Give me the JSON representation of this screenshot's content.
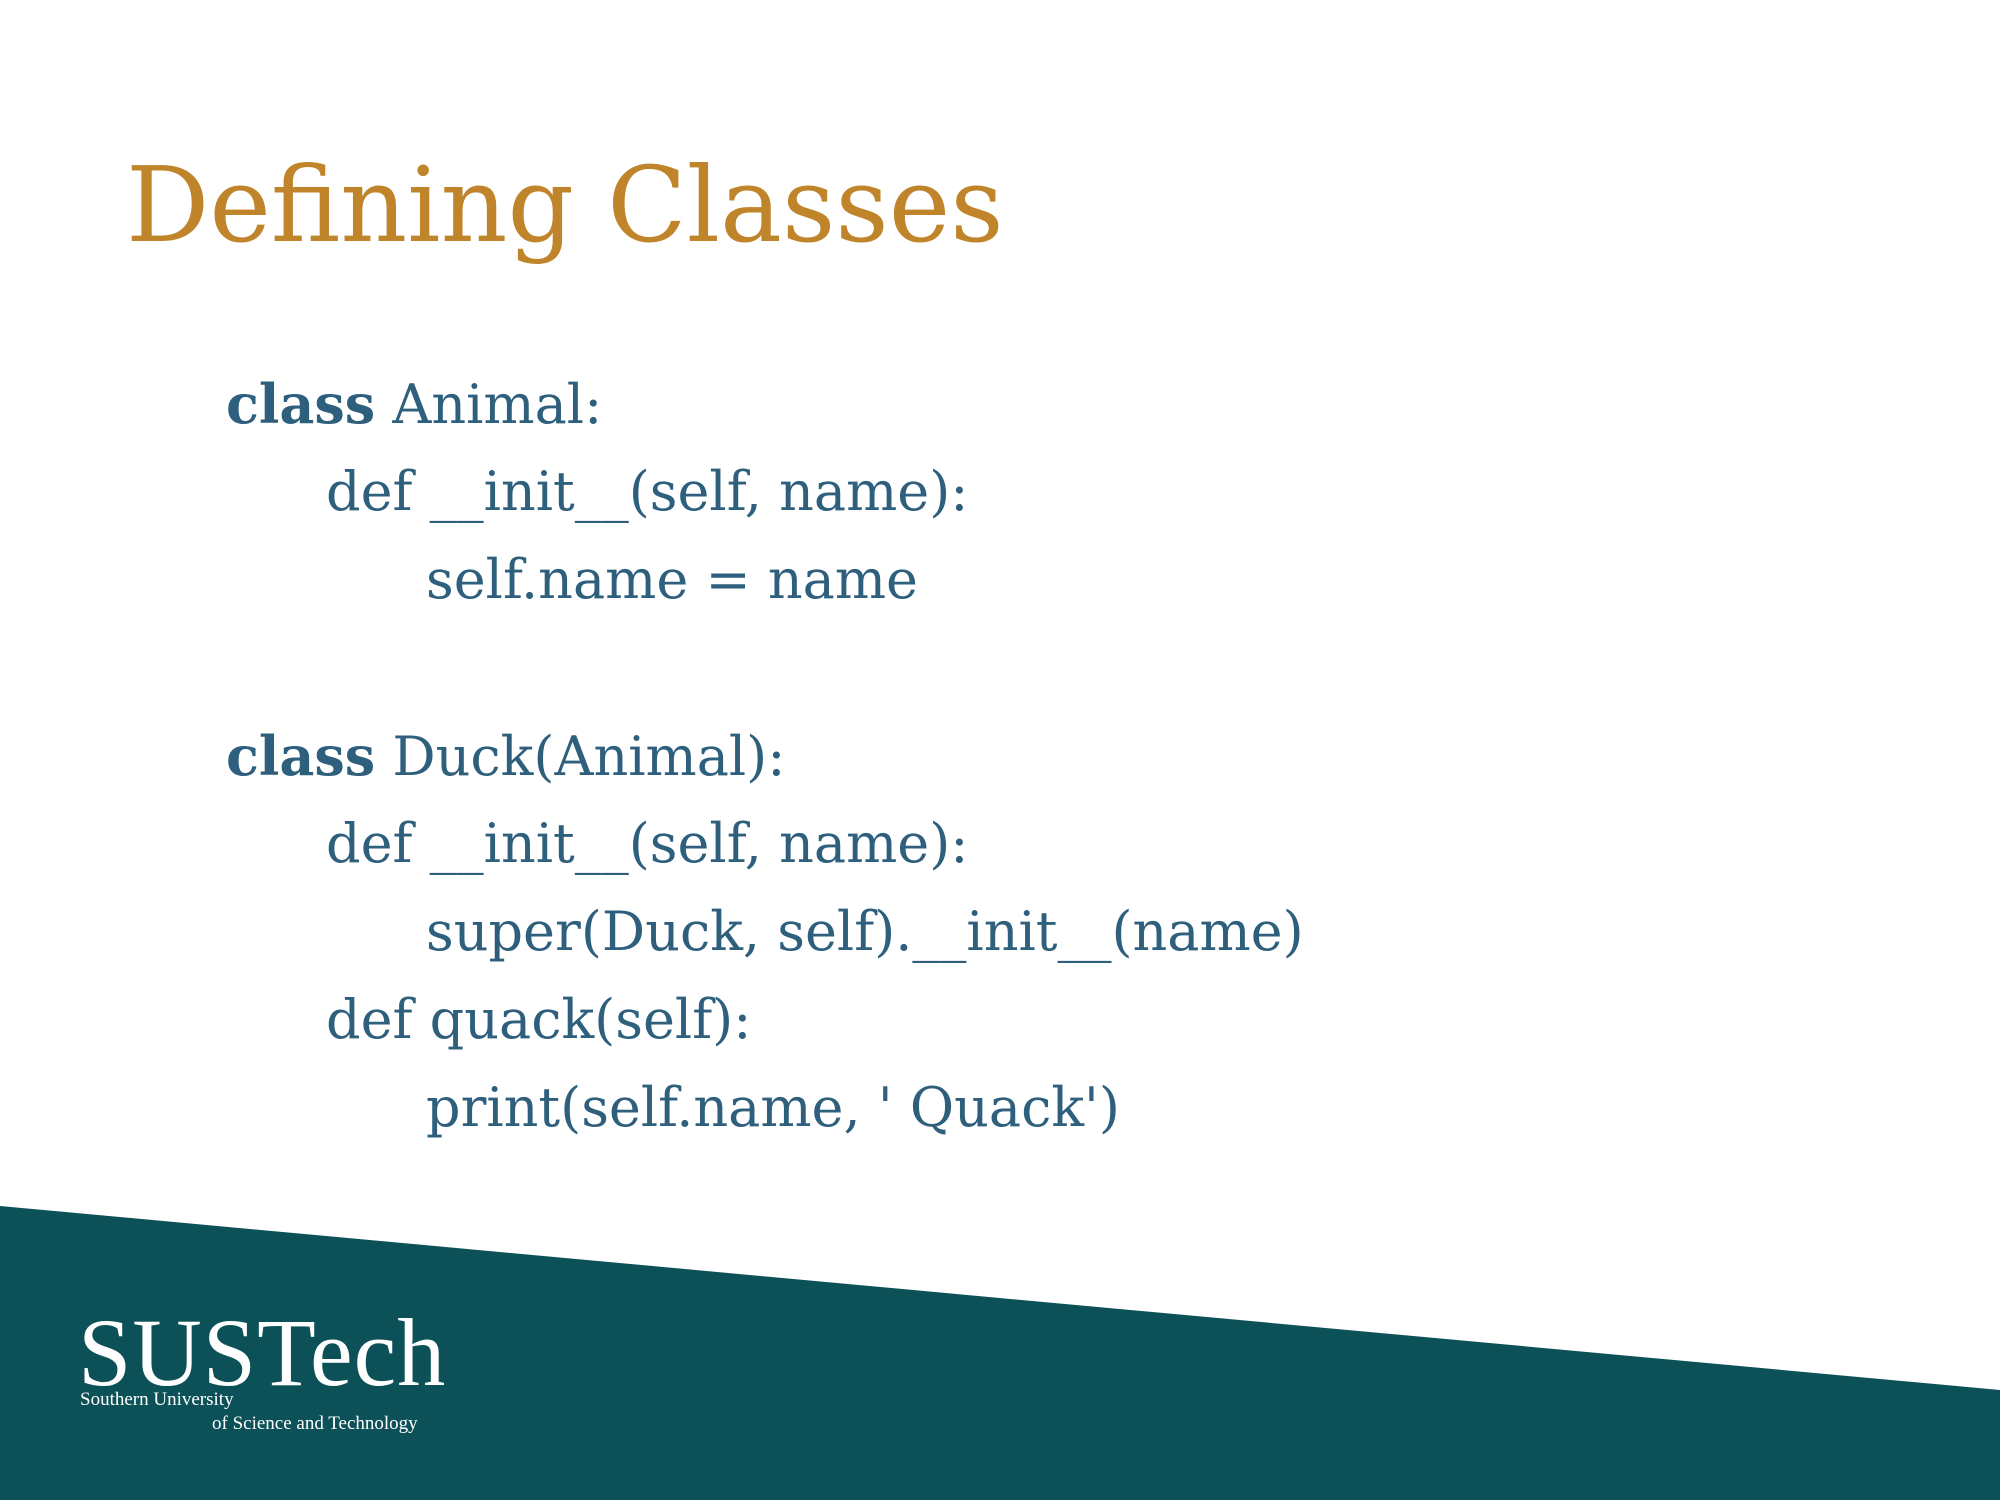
{
  "slide": {
    "title": "Defining Classes",
    "colors": {
      "title": "#c0842a",
      "code": "#2e5f7d",
      "footer_band": "#0d5158",
      "background": "#ffffff",
      "logo": "#ffffff"
    }
  },
  "code": {
    "lines": [
      {
        "keyword": "class",
        "text": " Animal:"
      },
      {
        "keyword": "",
        "text": "def __init__(self, name):"
      },
      {
        "keyword": "",
        "text": "self.name = name"
      },
      {
        "keyword": "",
        "text": ""
      },
      {
        "keyword": "class",
        "text": " Duck(Animal):"
      },
      {
        "keyword": "",
        "text": "def __init__(self, name):"
      },
      {
        "keyword": "",
        "text": "super(Duck, self).__init__(name)"
      },
      {
        "keyword": "",
        "text": "def quack(self):"
      },
      {
        "keyword": "",
        "text": "print(self.name, ' Quack')"
      }
    ]
  },
  "footer": {
    "logo": {
      "wordmark": "SUSTech",
      "subtitle_line1": "Southern University",
      "subtitle_line2": "of Science and Technology"
    }
  }
}
